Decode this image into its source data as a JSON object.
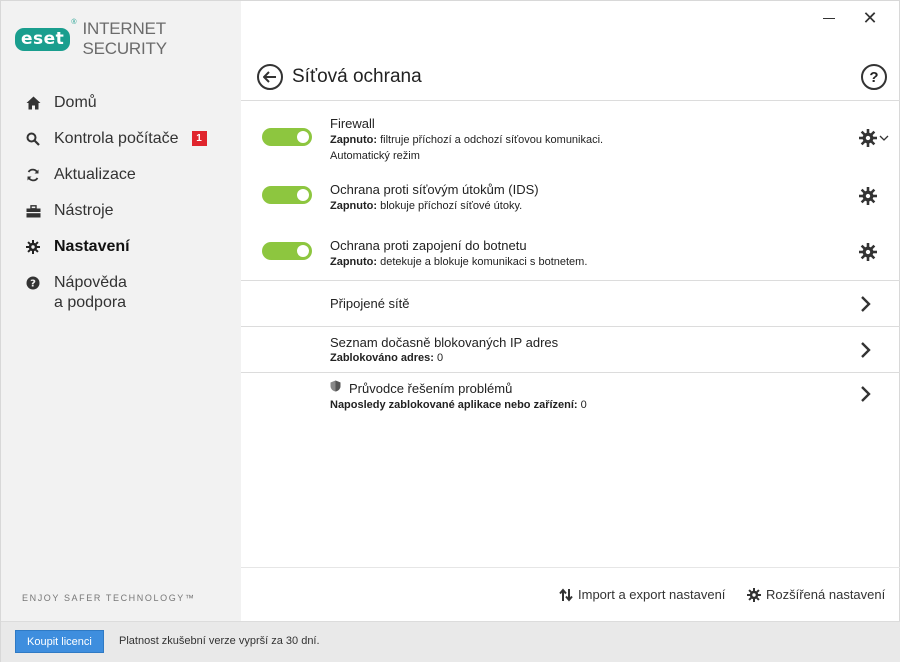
{
  "app": {
    "logo_text": "eset",
    "logo_mark": "®",
    "product_name": "INTERNET SECURITY"
  },
  "window": {
    "minimize_icon": "minimize-icon",
    "close_label": "✕"
  },
  "sidebar": {
    "items": [
      {
        "label": "Domů",
        "icon": "home-icon"
      },
      {
        "label": "Kontrola počítače",
        "icon": "search-icon",
        "badge": "1"
      },
      {
        "label": "Aktualizace",
        "icon": "refresh-icon"
      },
      {
        "label": "Nástroje",
        "icon": "toolbox-icon"
      },
      {
        "label": "Nastavení",
        "icon": "gear-icon",
        "active": true
      },
      {
        "label_line1": "Nápověda",
        "label_line2": "a podpora",
        "icon": "help-circle-icon"
      }
    ],
    "tagline": "ENJOY SAFER TECHNOLOGY™"
  },
  "header": {
    "title": "Síťová ochrana",
    "help_label": "?"
  },
  "protections": [
    {
      "title": "Firewall",
      "status_label": "Zapnuto:",
      "status_text": " filtruje příchozí a odchozí síťovou komunikaci.",
      "extra": "Automatický režim",
      "enabled": true
    },
    {
      "title": "Ochrana proti síťovým útokům (IDS)",
      "status_label": "Zapnuto:",
      "status_text": " blokuje příchozí síťové útoky.",
      "enabled": true
    },
    {
      "title": "Ochrana proti zapojení do botnetu",
      "status_label": "Zapnuto:",
      "status_text": " detekuje a blokuje komunikaci s botnetem.",
      "enabled": true
    }
  ],
  "links": [
    {
      "title": "Připojené sítě"
    },
    {
      "title": "Seznam dočasně blokovaných IP adres",
      "sub_label": "Zablokováno adres:",
      "sub_value": " 0"
    },
    {
      "title": "Průvodce řešením problémů",
      "sub_label": "Naposledy zablokované aplikace nebo zařízení:",
      "sub_value": " 0"
    }
  ],
  "footer": {
    "import_export": "Import a export nastavení",
    "advanced": "Rozšířená nastavení"
  },
  "statusbar": {
    "buy_button": "Koupit licenci",
    "trial_text": "Platnost zkušební verze vyprší za 30 dní."
  },
  "colors": {
    "brand": "#1a9e8e",
    "toggle_on": "#8dc63f",
    "badge": "#e0252d",
    "buy_button": "#3e8ede"
  }
}
